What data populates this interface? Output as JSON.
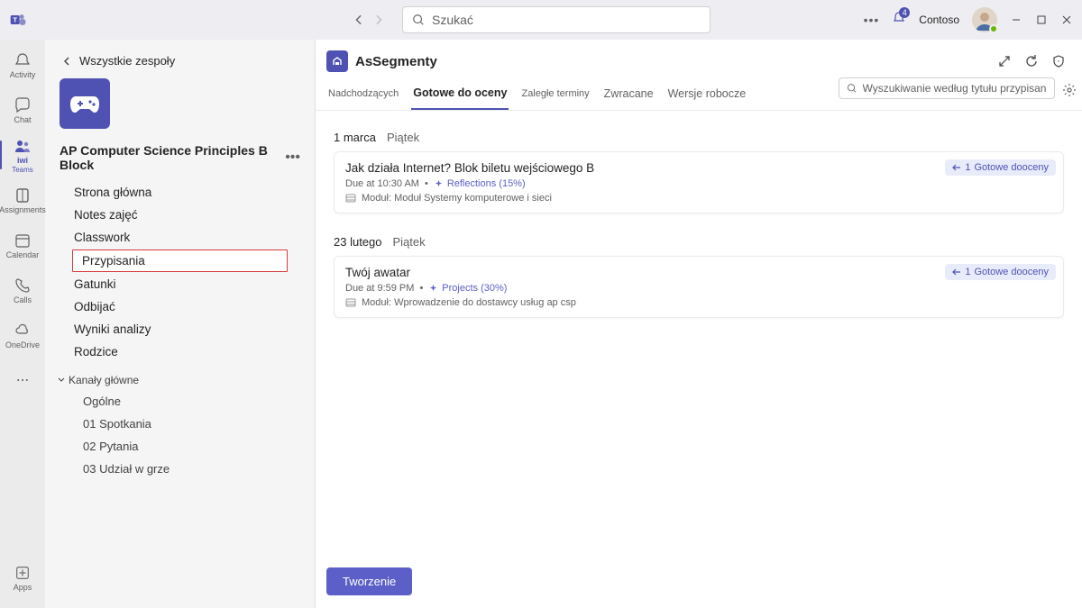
{
  "titlebar": {
    "search_placeholder": "Szukać",
    "org": "Contoso",
    "badge_count": "4"
  },
  "rail": {
    "items": [
      {
        "label": "Activity"
      },
      {
        "label": "Chat"
      },
      {
        "label": "iwi",
        "sub": "Teams"
      },
      {
        "label": "Assignments"
      },
      {
        "label": "Calendar"
      },
      {
        "label": "Calls"
      },
      {
        "label": "OneDrive"
      }
    ],
    "apps": "Apps"
  },
  "sidebar": {
    "all_teams": "Wszystkie zespoły",
    "team_name": "AP Computer Science Principles B Block",
    "nav": [
      "Strona główna",
      "Notes zajęć",
      "Classwork",
      "Przypisania",
      "Gatunki",
      "Odbijać",
      "Wyniki analizy",
      "Rodzice"
    ],
    "channels_head": "Kanały główne",
    "channels": [
      {
        "tag": "",
        "label": "Ogólne"
      },
      {
        "tag": "01",
        "label": "Spotkania"
      },
      {
        "tag": "02",
        "label": "Pytania"
      },
      {
        "tag": "03",
        "label": "Udział w grze"
      }
    ]
  },
  "main": {
    "title": "AsSegmenty",
    "tabs": [
      "Nadchodzących",
      "Gotowe do oceny",
      "Zaległe terminy",
      "Zwracane",
      "Wersje robocze"
    ],
    "filter_placeholder": "Wyszukiwanie według tytułu przypisania",
    "dates": [
      {
        "a": "1 marca",
        "b": "Piątek"
      },
      {
        "a": "23 lutego",
        "b": "Piątek"
      }
    ],
    "cards": [
      {
        "title": "Jak działa Internet? Blok biletu wejściowego B",
        "due": "Due at 10:30 AM",
        "refl": "Reflections (15%)",
        "module": "Moduł: Moduł Systemy komputerowe i sieci",
        "badge_num": "1",
        "badge_text": "Gotowe dooceny"
      },
      {
        "title": "Twój awatar",
        "due": "Due at 9:59 PM",
        "refl": "Projects (30%)",
        "module": "Moduł: Wprowadzenie do dostawcy usług ap csp",
        "badge_num": "1",
        "badge_text": "Gotowe dooceny"
      }
    ],
    "create": "Tworzenie"
  }
}
